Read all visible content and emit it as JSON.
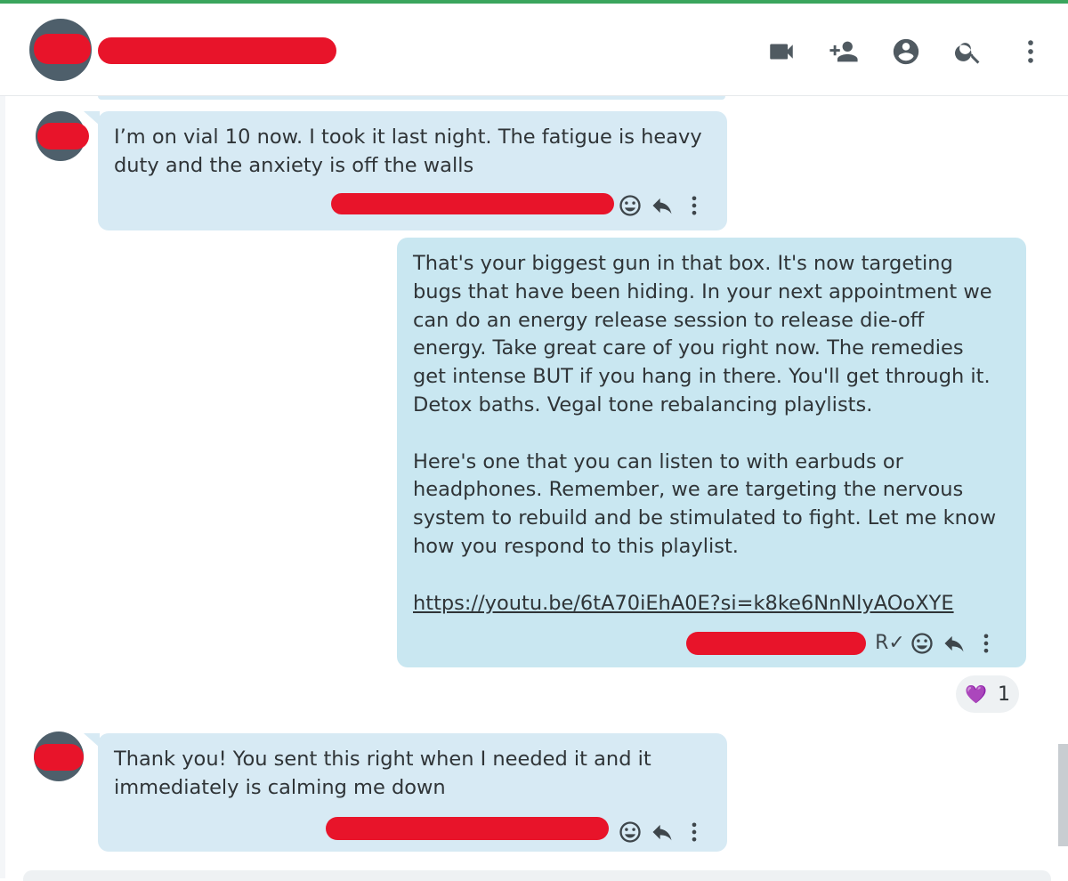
{
  "header": {
    "contact_name": "",
    "icons": [
      "video-call-icon",
      "add-person-icon",
      "account-icon",
      "search-icon",
      "more-vert-icon"
    ]
  },
  "messages": [
    {
      "direction": "received",
      "text": "I’m on vial 10 now. I took it last night. The fatigue is heavy\nduty and the anxiety is off the walls",
      "actions": [
        "emoji-icon",
        "reply-icon",
        "more-vert-icon"
      ]
    },
    {
      "direction": "sent",
      "text": "That's your biggest gun in that box. It's now targeting\nbugs that have been hiding. In your next appointment we\ncan do an energy release session to release die-off\nenergy. Take great care of you right now. The remedies\nget intense BUT if you hang in there. You'll get through it.\nDetox baths. Vegal tone rebalancing playlists.\n\nHere's one that you can listen to with earbuds or\nheadphones. Remember, we are targeting the nervous\nsystem to rebuild and be stimulated to fight. Let me know\nhow you respond to this playlist.",
      "link": "https://youtu.be/6tA70iEhA0E?si=k8ke6NnNlyAOoXYE",
      "read_mark": "R✓",
      "actions": [
        "emoji-icon",
        "reply-icon",
        "more-vert-icon"
      ],
      "reaction": {
        "emoji": "💜",
        "count": "1"
      }
    },
    {
      "direction": "received",
      "text": "Thank you! You sent this right when I needed it and it\nimmediately is calming me down",
      "actions": [
        "emoji-icon",
        "reply-icon",
        "more-vert-icon"
      ]
    }
  ],
  "colors": {
    "accent": "#3aa55d",
    "received_bubble": "#d7eaf4",
    "sent_bubble": "#c9e7f1",
    "redaction": "#e8142a",
    "reaction_heart": "#8a3ad8"
  }
}
